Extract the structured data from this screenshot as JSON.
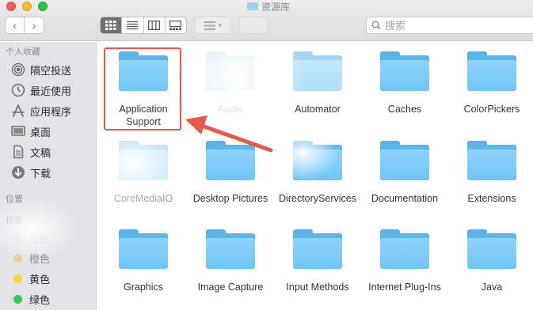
{
  "window": {
    "title": "资源库"
  },
  "search": {
    "placeholder": "搜索"
  },
  "sidebar": {
    "favorites_title": "个人收藏",
    "favorites": [
      {
        "label": "隔空投送",
        "icon": "airdrop-icon"
      },
      {
        "label": "最近使用",
        "icon": "recents-clock-icon"
      },
      {
        "label": "应用程序",
        "icon": "applications-icon"
      },
      {
        "label": "桌面",
        "icon": "desktop-icon"
      },
      {
        "label": "文稿",
        "icon": "documents-icon"
      },
      {
        "label": "下载",
        "icon": "downloads-icon"
      }
    ],
    "locations_title": "位置",
    "tags_title": "标签",
    "tags": [
      {
        "label": "红色",
        "color": "#fe6a5f"
      },
      {
        "label": "橙色",
        "color": "#fdb248"
      },
      {
        "label": "黄色",
        "color": "#fcd435"
      },
      {
        "label": "绿色",
        "color": "#34c759"
      }
    ]
  },
  "folders": [
    {
      "label": "Application Support"
    },
    {
      "label": "Audio"
    },
    {
      "label": "Automator"
    },
    {
      "label": "Caches"
    },
    {
      "label": "ColorPickers"
    },
    {
      "label": "CoreMediaIO"
    },
    {
      "label": "Desktop Pictures"
    },
    {
      "label": "DirectoryServices"
    },
    {
      "label": "Documentation"
    },
    {
      "label": "Extensions"
    },
    {
      "label": "Graphics"
    },
    {
      "label": "Image Capture"
    },
    {
      "label": "Input Methods"
    },
    {
      "label": "Internet Plug-Ins"
    },
    {
      "label": "Java"
    }
  ],
  "annotation": {
    "color": "#e9574a"
  }
}
